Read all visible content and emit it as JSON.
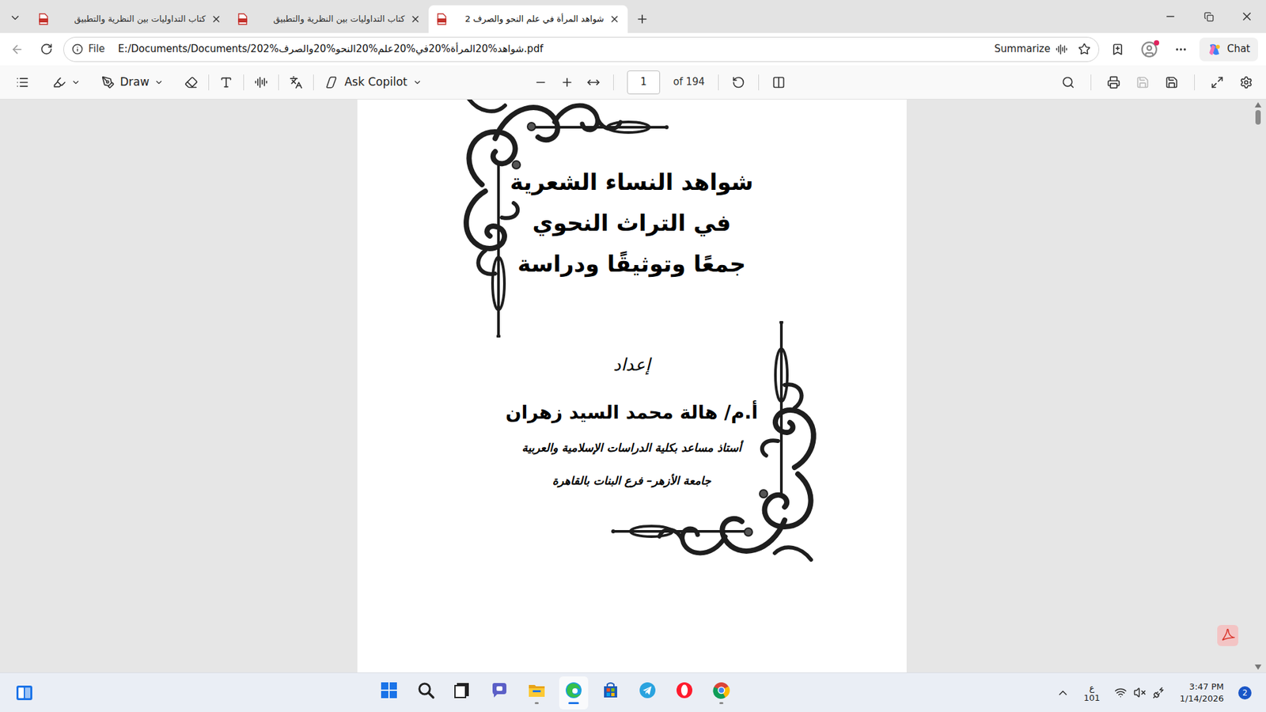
{
  "tabs": [
    {
      "title": "كتاب التداوليات بين النظرية والتطبيق",
      "selected": false
    },
    {
      "title": "كتاب التداوليات بين النظرية والتطبيق",
      "selected": false
    },
    {
      "title": "شواهد المرأة في علم النحو والصرف 2",
      "selected": true
    }
  ],
  "address_bar": {
    "scheme": "File",
    "url": "E:/Documents/Documents/شواهد%20المرأة%20في%20علم%20النحو%20والصرف%202.pdf",
    "summarize": "Summarize",
    "chat": "Chat",
    "profile_alert": true
  },
  "pdf_toolbar": {
    "draw": "Draw",
    "ask_copilot": "Ask Copilot",
    "page": "1",
    "page_count": "of 194"
  },
  "document": {
    "title_lines": [
      "شواهد النساء الشعرية",
      "في التراث النحوي",
      "جمعًا وتوثيقًا ودراسة"
    ],
    "prepared_by": "إعداد",
    "author": "أ.م/ هالة محمد السيد زهران",
    "affiliation_lines": [
      "أستاذ مساعد بكلية الدراسات الإسلامية والعربية",
      "جامعة الأزهر– فرع البنات بالقاهرة"
    ]
  },
  "taskbar": {
    "apps": [
      {
        "kind": "start",
        "running": false,
        "active": false
      },
      {
        "kind": "search",
        "running": false,
        "active": false
      },
      {
        "kind": "taskview",
        "running": false,
        "active": false
      },
      {
        "kind": "meet",
        "running": false,
        "active": false
      },
      {
        "kind": "explorer",
        "running": true,
        "active": false
      },
      {
        "kind": "edge",
        "running": true,
        "active": true
      },
      {
        "kind": "store",
        "running": false,
        "active": false
      },
      {
        "kind": "telegram",
        "running": false,
        "active": false
      },
      {
        "kind": "opera",
        "running": false,
        "active": false
      },
      {
        "kind": "chrome",
        "running": true,
        "active": false
      }
    ],
    "language": "ع",
    "language_sub": "101",
    "muted": true,
    "time": "3:47 PM",
    "date": "1/14/2026",
    "notifications": "2"
  }
}
